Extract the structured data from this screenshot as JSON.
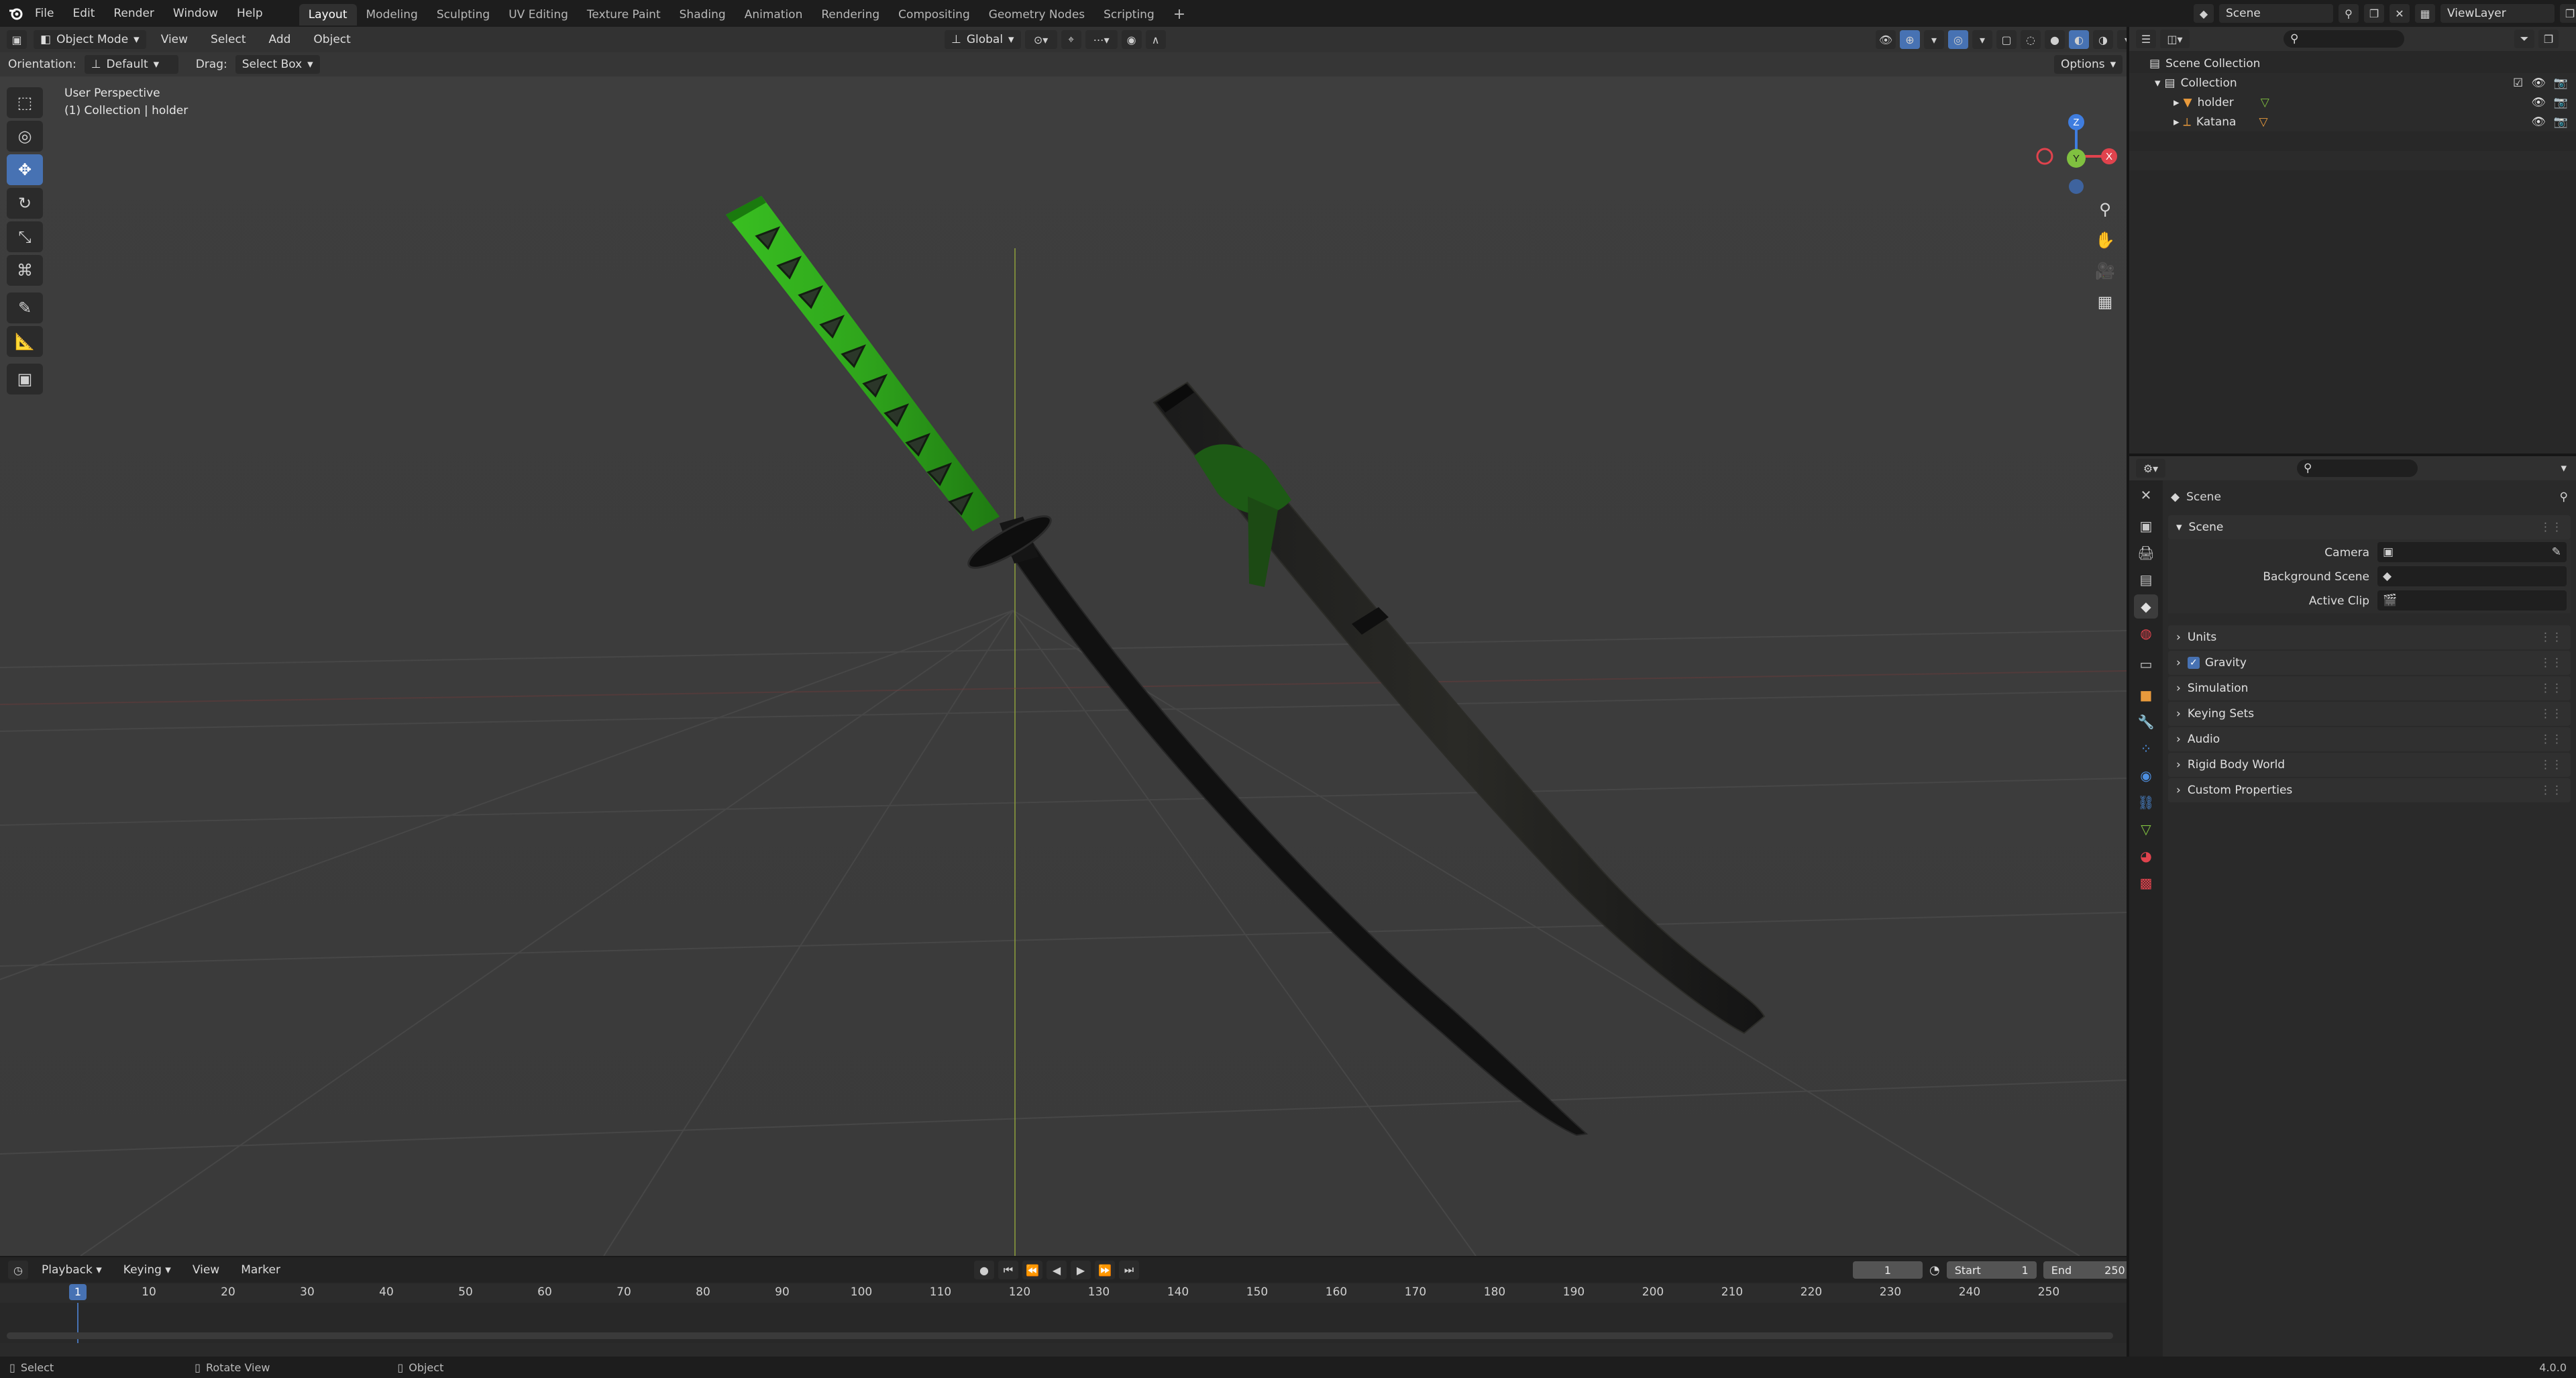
{
  "topbar": {
    "menus": [
      "File",
      "Edit",
      "Render",
      "Window",
      "Help"
    ],
    "workspaces": [
      "Layout",
      "Modeling",
      "Sculpting",
      "UV Editing",
      "Texture Paint",
      "Shading",
      "Animation",
      "Rendering",
      "Compositing",
      "Geometry Nodes",
      "Scripting"
    ],
    "active_workspace": "Layout",
    "scene_name": "Scene",
    "view_layer": "ViewLayer"
  },
  "viewport": {
    "mode": "Object Mode",
    "menus": [
      "View",
      "Select",
      "Add",
      "Object"
    ],
    "transform_orientation": "Global",
    "tool_settings": {
      "orientation_label": "Orientation:",
      "orientation_value": "Default",
      "drag_label": "Drag:",
      "drag_value": "Select Box",
      "options": "Options"
    },
    "overlay": {
      "view_name": "User Perspective",
      "collection_info": "(1) Collection | holder"
    },
    "gizmo": {
      "z": "Z",
      "x": "X",
      "y": "Y"
    }
  },
  "timeline": {
    "menus": [
      "Playback",
      "Keying",
      "View",
      "Marker"
    ],
    "current_frame": "1",
    "start_label": "Start",
    "start_value": "1",
    "end_label": "End",
    "end_value": "250",
    "ticks": [
      "10",
      "20",
      "30",
      "40",
      "50",
      "60",
      "70",
      "80",
      "90",
      "100",
      "110",
      "120",
      "130",
      "140",
      "150",
      "160",
      "170",
      "180",
      "190",
      "200",
      "210",
      "220",
      "230",
      "240",
      "250"
    ]
  },
  "statusbar": {
    "select": "Select",
    "rotate": "Rotate View",
    "object": "Object",
    "version": "4.0.0"
  },
  "outliner": {
    "root": "Scene Collection",
    "collection": "Collection",
    "items": [
      "holder",
      "Katana"
    ]
  },
  "properties": {
    "context": "Scene",
    "panel_title": "Scene",
    "camera_label": "Camera",
    "background_scene_label": "Background Scene",
    "active_clip_label": "Active Clip",
    "sections": [
      "Units",
      "Gravity",
      "Simulation",
      "Keying Sets",
      "Audio",
      "Rigid Body World",
      "Custom Properties"
    ]
  },
  "colors": {
    "accent": "#4772b3",
    "viewport_bg": "#3d3d3d",
    "hilt_green": "#2fa51c",
    "x_axis": "#e0434d",
    "y_axis": "#80c040",
    "z_axis": "#3f7ddf"
  }
}
